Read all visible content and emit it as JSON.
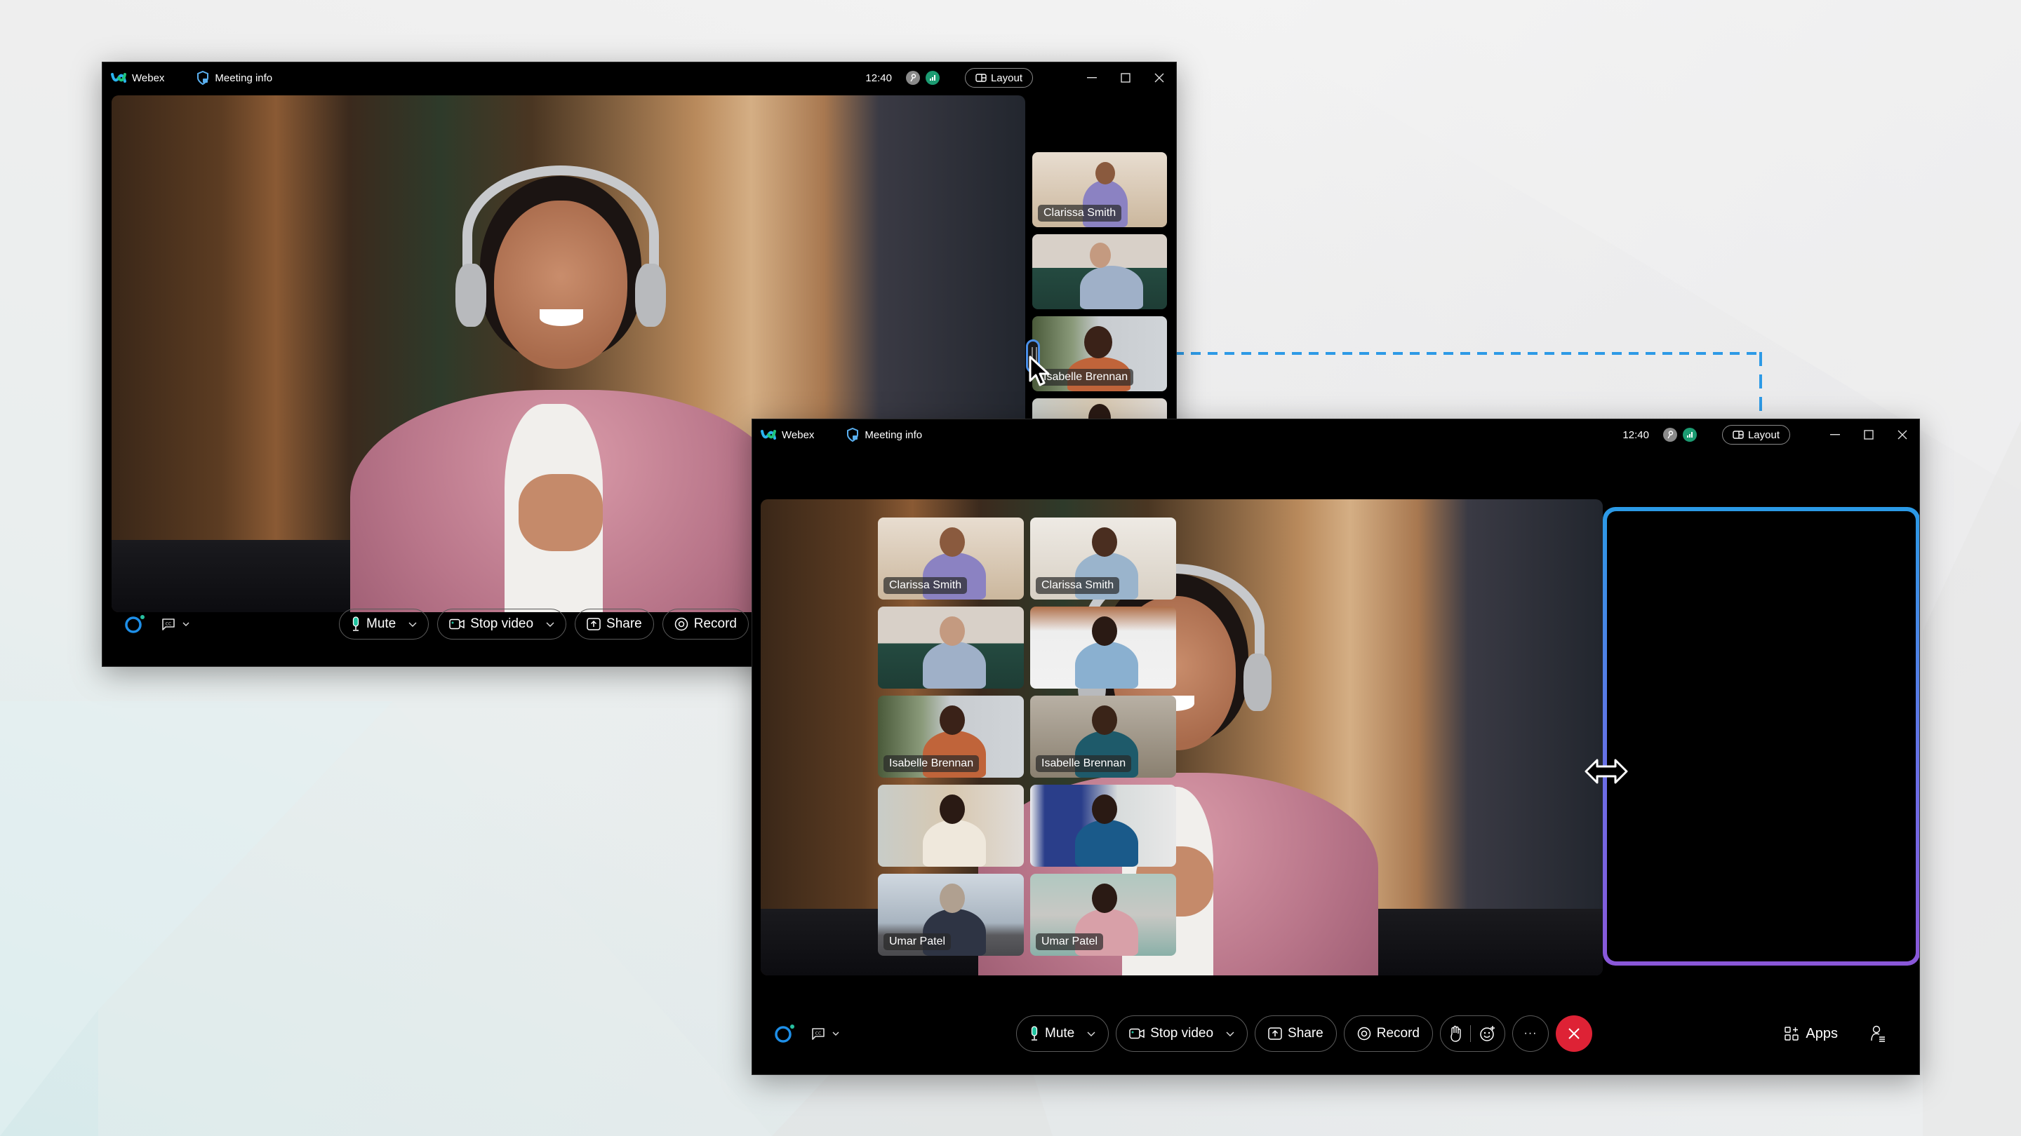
{
  "background": {
    "colors": [
      "#f4f4f4",
      "#d6eaeb"
    ]
  },
  "accent": {
    "grid_frame_top": "#2b9ae6",
    "grid_frame_bottom": "#8a57d9",
    "connector": "#2d9ae6",
    "end_call": "#de2235",
    "status_green": "#1c9b72"
  },
  "windows": [
    {
      "id": "before",
      "titlebar": {
        "app_name": "Webex",
        "meeting_info": "Meeting info",
        "time": "12:40",
        "layout_label": "Layout"
      },
      "filmstrip": [
        {
          "name": "Clarissa Smith",
          "scene": "room-lilac"
        },
        {
          "name": "",
          "scene": "sofa-green"
        },
        {
          "name": "Isabelle Brennan",
          "scene": "office-plant"
        },
        {
          "name": "",
          "scene": "kitchen"
        }
      ],
      "toolbar": {
        "mute": "Mute",
        "stop_video": "Stop video",
        "share": "Share",
        "record": "Record"
      }
    },
    {
      "id": "after",
      "titlebar": {
        "app_name": "Webex",
        "meeting_info": "Meeting info",
        "time": "12:40",
        "layout_label": "Layout"
      },
      "grid": [
        {
          "name": "Clarissa Smith"
        },
        {
          "name": "Clarissa Smith"
        },
        {
          "name": ""
        },
        {
          "name": ""
        },
        {
          "name": "Isabelle Brennan"
        },
        {
          "name": "Isabelle Brennan"
        },
        {
          "name": ""
        },
        {
          "name": ""
        },
        {
          "name": "Umar Patel"
        },
        {
          "name": "Umar Patel"
        }
      ],
      "toolbar": {
        "mute": "Mute",
        "stop_video": "Stop video",
        "share": "Share",
        "record": "Record",
        "more": "···",
        "apps": "Apps"
      }
    }
  ],
  "icons": {
    "webex_logo": "webex-logo-icon",
    "meeting_info": "shield-lock-icon",
    "connection": "key-icon",
    "signal": "signal-bars-icon",
    "layout": "layout-icon",
    "minimize": "minimize-icon",
    "maximize": "maximize-icon",
    "close": "close-icon",
    "ai_assistant": "assistant-ring-icon",
    "captions": "closed-captions-icon",
    "mic": "microphone-icon",
    "camera": "camera-icon",
    "share": "share-icon",
    "record": "record-icon",
    "raise_hand": "raise-hand-icon",
    "reactions": "reactions-icon",
    "end_call": "end-call-icon",
    "apps": "apps-icon",
    "participants": "participants-icon",
    "resize": "resize-horizontal-icon",
    "cursor": "pointer-cursor-icon"
  }
}
